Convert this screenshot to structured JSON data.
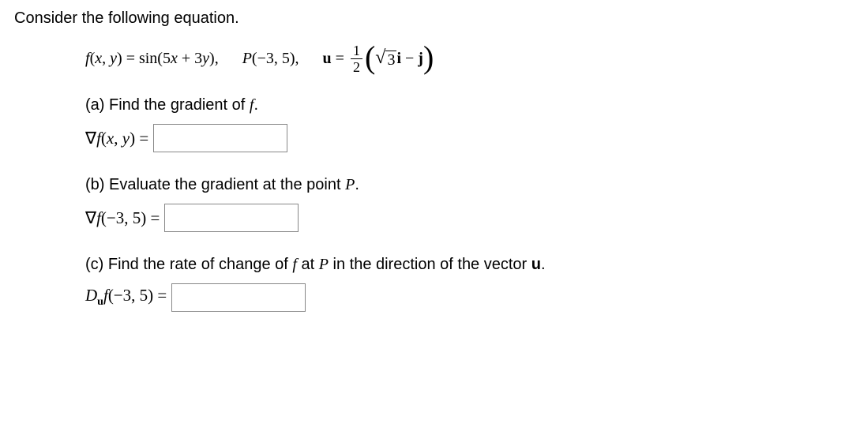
{
  "intro": "Consider the following equation.",
  "equation": {
    "func_lhs": "f",
    "func_args": "(x, y)",
    "equals": " = ",
    "func_rhs": "sin(5x + 3y),",
    "point_label": "P",
    "point_value": "(−3, 5),",
    "vector_label": "u",
    "vector_equals": " = ",
    "frac_num": "1",
    "frac_den": "2",
    "sqrt_arg": "3",
    "vec_i": "i",
    "minus": " − ",
    "vec_j": "j"
  },
  "parts": {
    "a": {
      "label": "(a) Find the gradient of ",
      "label_f": "f",
      "label_end": ".",
      "answer_prefix": "∇f",
      "answer_args": "(x, y)",
      "answer_eq": " = "
    },
    "b": {
      "label": "(b) Evaluate the gradient at the point ",
      "label_p": "P",
      "label_end": ".",
      "answer_prefix": "∇f",
      "answer_args": "(−3, 5)",
      "answer_eq": " = "
    },
    "c": {
      "label_1": "(c) Find the rate of change of ",
      "label_f": "f",
      "label_2": " at ",
      "label_p": "P",
      "label_3": " in the direction of the vector ",
      "label_u": "u",
      "label_end": ".",
      "answer_D": "D",
      "answer_sub": "u",
      "answer_f": "f",
      "answer_args": "(−3, 5)",
      "answer_eq": " = "
    }
  }
}
